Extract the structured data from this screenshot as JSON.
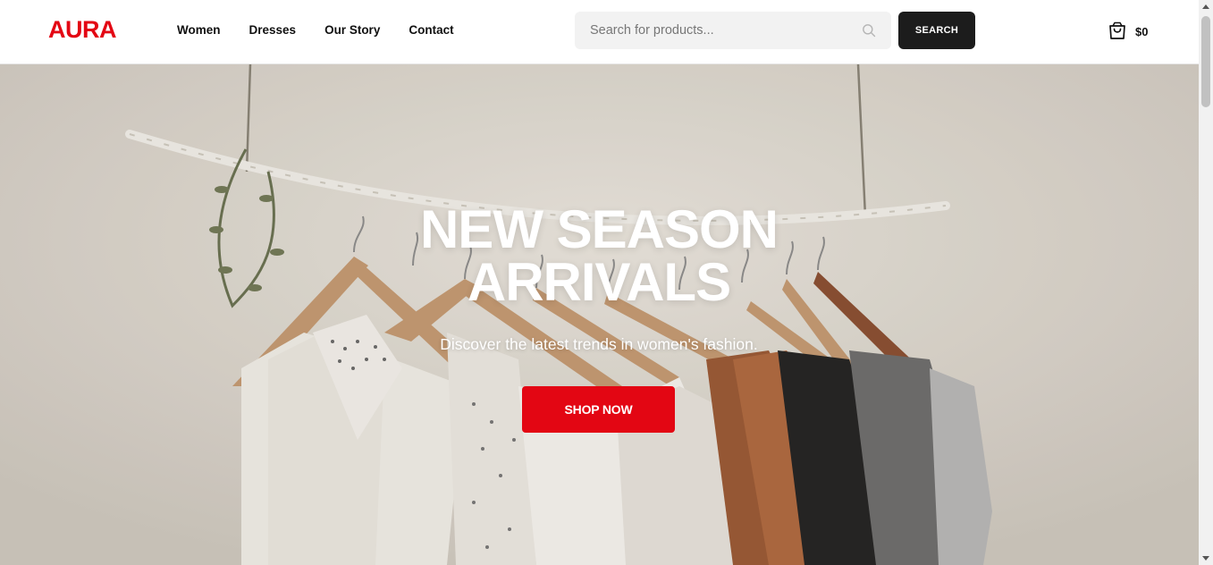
{
  "colors": {
    "brand": "#e30613",
    "dark": "#1c1c1c"
  },
  "header": {
    "logo": "AURA",
    "nav": [
      {
        "label": "Women"
      },
      {
        "label": "Dresses"
      },
      {
        "label": "Our Story"
      },
      {
        "label": "Contact"
      }
    ],
    "search": {
      "placeholder": "Search for products...",
      "value": "",
      "icon": "search-icon",
      "button_label": "SEARCH"
    },
    "cart": {
      "icon": "shopping-bag-icon",
      "total": "$0"
    }
  },
  "hero": {
    "title": "NEW SEASON ARRIVALS",
    "subtitle": "Discover the latest trends in women's fashion.",
    "cta_label": "SHOP NOW"
  }
}
